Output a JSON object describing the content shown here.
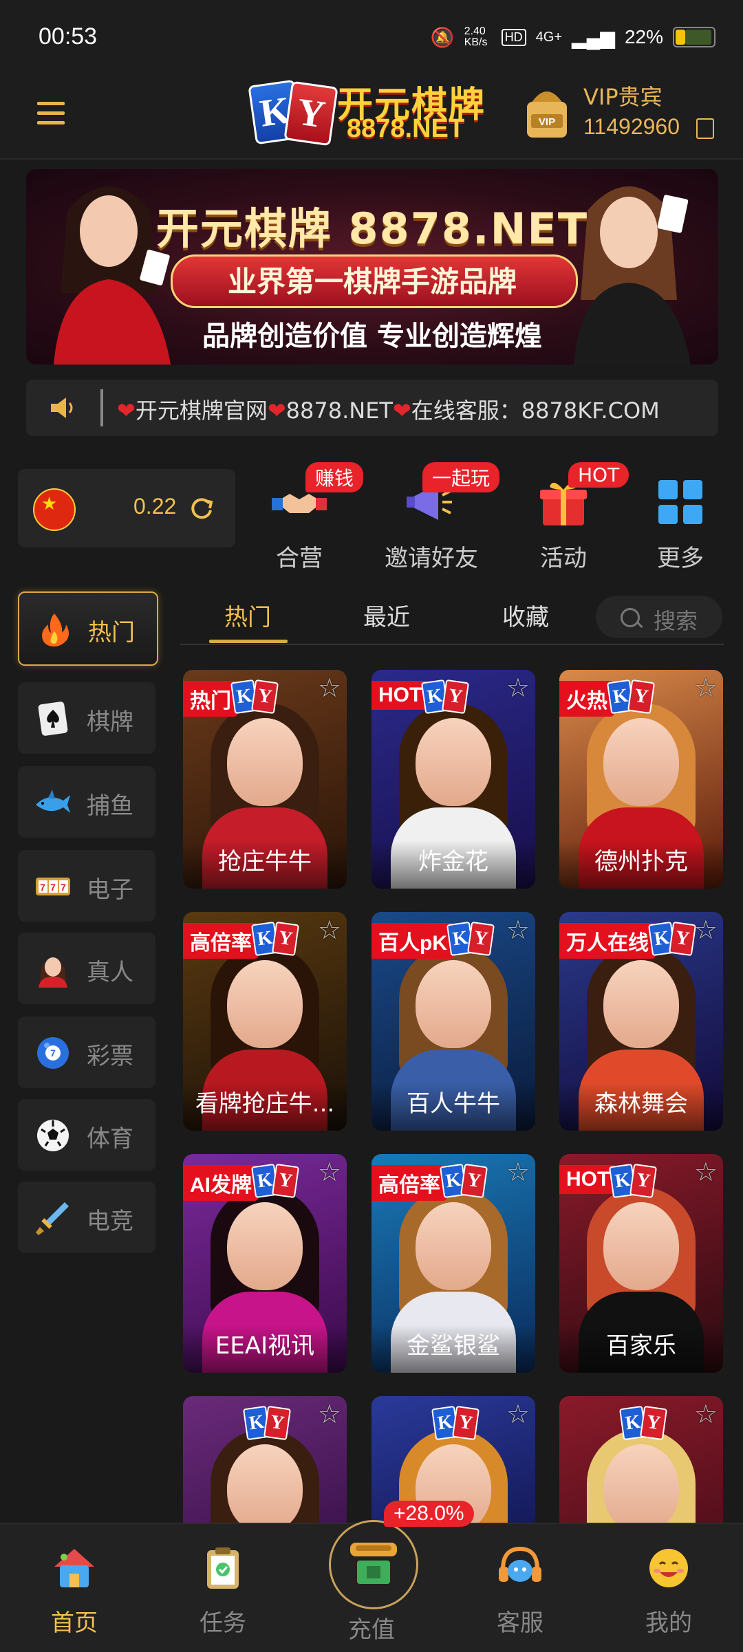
{
  "status_bar": {
    "time": "00:53",
    "net_speed": "2.40 KB/s",
    "network": "4G+",
    "battery": "22%"
  },
  "header": {
    "logo_title": "开元棋牌",
    "logo_sub": "8878.NET",
    "vip_label": "VIP贵宾",
    "vip_id": "11492960"
  },
  "banner": {
    "title": "开元棋牌 8878.NET",
    "ribbon": "业界第一棋牌手游品牌",
    "slogan": "品牌创造价值 专业创造辉煌"
  },
  "marquee": {
    "text_1": "开元棋牌官网",
    "text_2": "8878.NET",
    "text_3": "在线客服：8878KF.COM"
  },
  "wallet": {
    "balance": "0.22"
  },
  "quick_actions": [
    {
      "label": "合营",
      "tag": "赚钱",
      "icon": "handshake-icon"
    },
    {
      "label": "邀请好友",
      "tag": "一起玩",
      "icon": "megaphone-icon"
    },
    {
      "label": "活动",
      "tag": "HOT",
      "icon": "gift-icon"
    },
    {
      "label": "更多",
      "tag": "",
      "icon": "grid-icon"
    }
  ],
  "sidebar": {
    "items": [
      {
        "label": "热门",
        "icon": "fire-icon"
      },
      {
        "label": "棋牌",
        "icon": "spade-card-icon"
      },
      {
        "label": "捕鱼",
        "icon": "shark-icon"
      },
      {
        "label": "电子",
        "icon": "slot-machine-icon"
      },
      {
        "label": "真人",
        "icon": "dealer-icon"
      },
      {
        "label": "彩票",
        "icon": "lottery-ball-icon"
      },
      {
        "label": "体育",
        "icon": "soccer-ball-icon"
      },
      {
        "label": "电竞",
        "icon": "sword-icon"
      }
    ]
  },
  "tabs": {
    "items": [
      "热门",
      "最近",
      "收藏"
    ],
    "search_label": "搜索"
  },
  "games": [
    {
      "name": "抢庄牛牛",
      "badge": "热门"
    },
    {
      "name": "炸金花",
      "badge": "HOT"
    },
    {
      "name": "德州扑克",
      "badge": "火热"
    },
    {
      "name": "看牌抢庄牛...",
      "badge": "高倍率"
    },
    {
      "name": "百人牛牛",
      "badge": "百人pK"
    },
    {
      "name": "森林舞会",
      "badge": "万人在线"
    },
    {
      "name": "EEAI视讯",
      "badge": "AI发牌"
    },
    {
      "name": "金鲨银鲨",
      "badge": "高倍率"
    },
    {
      "name": "百家乐",
      "badge": "HOT"
    },
    {
      "name": "",
      "badge": ""
    },
    {
      "name": "",
      "badge": ""
    },
    {
      "name": "",
      "badge": ""
    }
  ],
  "bottom_nav": {
    "items": [
      {
        "label": "首页",
        "icon": "home-icon"
      },
      {
        "label": "任务",
        "icon": "clipboard-icon"
      },
      {
        "label": "充值",
        "icon": "wallet-icon"
      },
      {
        "label": "客服",
        "icon": "headset-icon"
      },
      {
        "label": "我的",
        "icon": "smiley-icon"
      }
    ],
    "recharge_bonus": "+28.0%"
  },
  "colors": {
    "accent": "#f2c14f",
    "background": "#1a1a1a",
    "badge_red": "#e5101e"
  }
}
